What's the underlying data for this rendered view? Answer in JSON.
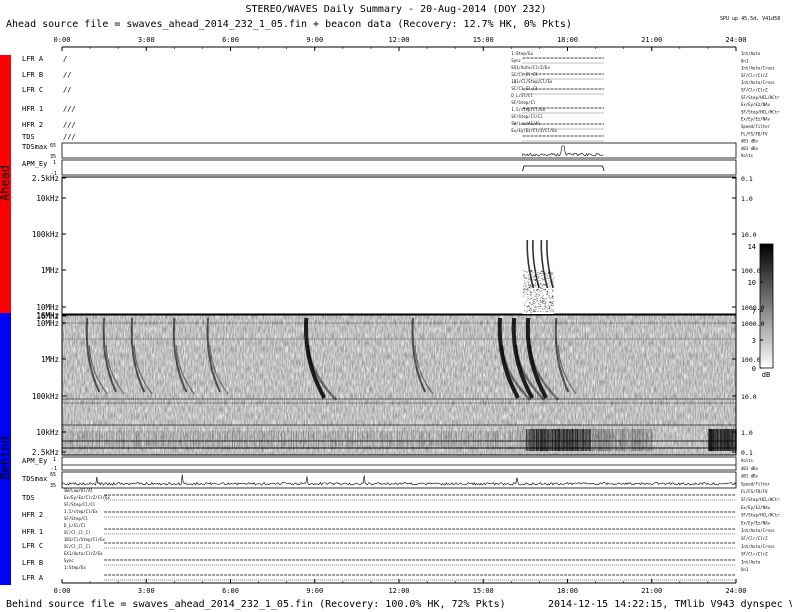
{
  "header": {
    "title": "STEREO/WAVES Daily Summary - 20-Aug-2014 (DOY 232)",
    "ahead_source": "Ahead source file = swaves_ahead_2014_232_1_05.fin + beacon data (Recovery: 12.7% HK,   0% Pkts)",
    "version": "SPU up 45.5d, V41d58"
  },
  "footer": {
    "behind_source": "Behind source file = swaves_ahead_2014_232_1_05.fin (Recovery: 100.0% HK,  72% Pkts)",
    "stamp": "2014-12-15 14:22:15, TMlib V943 dynspec V210"
  },
  "side_labels": {
    "ahead": "Ahead",
    "behind": "Behind"
  },
  "colors": {
    "ahead": "#ff0000",
    "behind": "#0000ff",
    "background": "#ffffff",
    "ink": "#000000"
  },
  "chart_data": [
    {
      "type": "heatmap",
      "name": "ahead-spectrogram",
      "x_ticks": [
        "0:00",
        "3:00",
        "6:00",
        "9:00",
        "12:00",
        "15:00",
        "18:00",
        "21:00",
        "24:00"
      ],
      "y_labels_left": [
        "2.5kHz",
        "10kHz",
        "100kHz",
        "1MHz",
        "10MHz",
        "16MHz"
      ],
      "y_labels_right": [
        "0.1",
        "1.0",
        "10.0",
        "100.0",
        "1000.0",
        "10000.0"
      ],
      "data_gap_hours": [
        0,
        16.4
      ],
      "bursts_hours": [
        16.5,
        16.7,
        17.0,
        17.2
      ]
    },
    {
      "type": "heatmap",
      "name": "behind-spectrogram",
      "y_labels_left": [
        "16MHz",
        "10MHz",
        "1MHz",
        "100kHz",
        "10kHz",
        "2.5kHz"
      ],
      "y_labels_right": [
        "10000.0",
        "1000.0",
        "100.0",
        "10.0",
        "1.0",
        "0.1"
      ],
      "bursts_hours": [
        0.9,
        1.5,
        2.5,
        4.0,
        5.2,
        8.7,
        12.5,
        15.6,
        16.1,
        16.6,
        17.6
      ]
    },
    {
      "type": "colorbar",
      "ticks": [
        "14",
        "10",
        "7",
        "3",
        "0"
      ],
      "unit": "dB"
    }
  ],
  "ahead_rows": [
    {
      "label": "LFR A",
      "marks": "/"
    },
    {
      "label": "LFR B",
      "marks": "//"
    },
    {
      "label": "LFR C",
      "marks": "//"
    },
    {
      "label": "HFR 1",
      "marks": "///"
    },
    {
      "label": "HFR 2",
      "marks": "///"
    },
    {
      "label": "TDS",
      "marks": "///"
    },
    {
      "label": "TDSmax",
      "marks": ""
    },
    {
      "label": "APM_Ey",
      "marks": ""
    }
  ],
  "ahead_axis_values": {
    "tdsmax_top": "65",
    "tdsmax_bot": "35",
    "apm_top": "1",
    "apm_bot": "-1"
  },
  "behind_rows": [
    {
      "label": "APM_Ey"
    },
    {
      "label": "TDSmax"
    },
    {
      "label": "TDS"
    },
    {
      "label": "HFR 2"
    },
    {
      "label": "HFR 1"
    },
    {
      "label": "LFR C"
    },
    {
      "label": "LFR B"
    },
    {
      "label": "LFR A"
    }
  ],
  "behind_axis_values": {
    "apm_top": "1",
    "apm_bot": "-1",
    "tdsmax_top": "65",
    "tdsmax_bot": "35"
  },
  "right_notes_ahead": [
    "Int/Auto",
    "On1",
    "Int/Auto/Cross",
    "SF/Clr/ClrZ",
    "Int/Auto/Cross",
    "SF/Clr/ClrZ",
    "SF/Step/HCL/HCtr",
    "Ex/Ey/Ez/NAv",
    "SF/Step/HCL/HCtr",
    "Ex/Ey/Ez/NAv",
    "Speed/Filter",
    "FL/FS/FD/FV",
    "dB1 dBv",
    "dB1 dBv",
    "Volts"
  ],
  "right_notes_behind": [
    "Volts",
    "dB1 dBv",
    "dB1 dBv",
    "Speed/Filter",
    "FL/FS/FD/FV",
    "SF/Step/HCL/HCtr",
    "Ex/Ey/Ez/NAv",
    "SF/Step/HCL/HCtr",
    "Ex/Ey/Ez/NAv",
    "Int/Auto/Cross",
    "SF/Clr/ClrZ",
    "Int/Auto/Cross",
    "SF/Clr/ClrZ",
    "Int/Auto",
    "On1"
  ],
  "mid_notes_ahead": [
    "1:Step/Ex",
    "Sync",
    "EX1/Auto/ClrZ/Ex",
    "SC/Cl_Cl_Cl",
    "1B1/Cl/Step/Cl/Ex",
    "SC/Cl_Cl_Cl",
    "D_L/Sl/Cl",
    "SF/Step/Cl",
    "1.5/step/Cl/Ex",
    "SF/Step/Cl/Cl",
    "SW/Low/Al/Al",
    "Ex/Ey/Ez/ClrZ/Cl/Ex"
  ],
  "mid_notes_behind": [
    "SW/Low/Al/Al",
    "Ex/Ey/Ez/ClrZ/Cl/Ex",
    "SF/Step/Cl/Cl",
    "1.5/step/Cl/Ex",
    "SF/Step/Cl",
    "D_L/Sl/Cl",
    "SC/Cl_Cl_Cl",
    "1B1/Cl/Step/Cl/Ex",
    "SC/Cl_Cl_Cl",
    "EX1/Auto/ClrZ/Ex",
    "Sync",
    "1:Step/Ex"
  ]
}
